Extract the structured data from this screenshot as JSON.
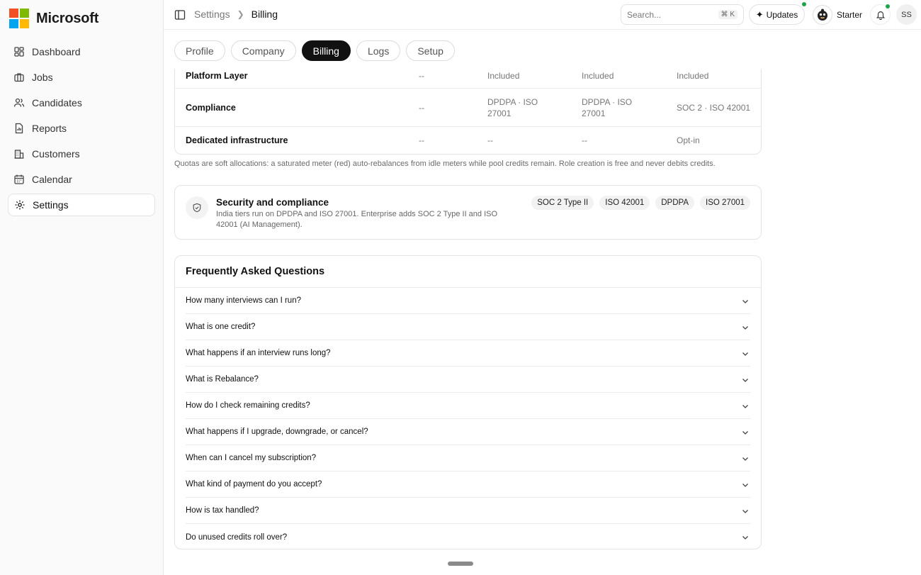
{
  "brand": {
    "name": "Microsoft"
  },
  "sidebar": {
    "items": [
      {
        "label": "Dashboard",
        "icon": "dashboard-icon"
      },
      {
        "label": "Jobs",
        "icon": "briefcase-icon"
      },
      {
        "label": "Candidates",
        "icon": "users-icon"
      },
      {
        "label": "Reports",
        "icon": "report-icon"
      },
      {
        "label": "Customers",
        "icon": "building-icon"
      },
      {
        "label": "Calendar",
        "icon": "calendar-icon"
      },
      {
        "label": "Settings",
        "icon": "gear-icon",
        "active": true
      }
    ]
  },
  "header": {
    "breadcrumb": [
      "Settings",
      "Billing"
    ],
    "search_placeholder": "Search...",
    "search_shortcut": "⌘ K",
    "updates_label": "Updates",
    "plan_label": "Starter",
    "user_initials": "SS"
  },
  "tabs": [
    {
      "label": "Profile"
    },
    {
      "label": "Company"
    },
    {
      "label": "Billing",
      "active": true
    },
    {
      "label": "Logs"
    },
    {
      "label": "Setup"
    }
  ],
  "plan_table": {
    "rows": [
      {
        "feature": "Platform Layer",
        "values": [
          "--",
          "Included",
          "Included",
          "Included"
        ]
      },
      {
        "feature": "Compliance",
        "values": [
          "--",
          "DPDPA · ISO 27001",
          "DPDPA · ISO 27001",
          "SOC 2 · ISO 42001"
        ]
      },
      {
        "feature": "Dedicated infrastructure",
        "values": [
          "--",
          "--",
          "--",
          "Opt-in"
        ]
      }
    ]
  },
  "quota_note": "Quotas are soft allocations: a saturated meter (red) auto-rebalances from idle meters while pool credits remain. Role creation is free and never debits credits.",
  "security": {
    "title": "Security and compliance",
    "description": "India tiers run on DPDPA and ISO 27001. Enterprise adds SOC 2 Type II and ISO 42001 (AI Management).",
    "badges": [
      "SOC 2 Type II",
      "ISO 42001",
      "DPDPA",
      "ISO 27001"
    ]
  },
  "faq": {
    "title": "Frequently Asked Questions",
    "items": [
      "How many interviews can I run?",
      "What is one credit?",
      "What happens if an interview runs long?",
      "What is Rebalance?",
      "How do I check remaining credits?",
      "What happens if I upgrade, downgrade, or cancel?",
      "When can I cancel my subscription?",
      "What kind of payment do you accept?",
      "How is tax handled?",
      "Do unused credits roll over?"
    ]
  },
  "colors": {
    "accent": "#111111",
    "status_dot": "#1fa34a",
    "border": "#e4e4e4"
  }
}
